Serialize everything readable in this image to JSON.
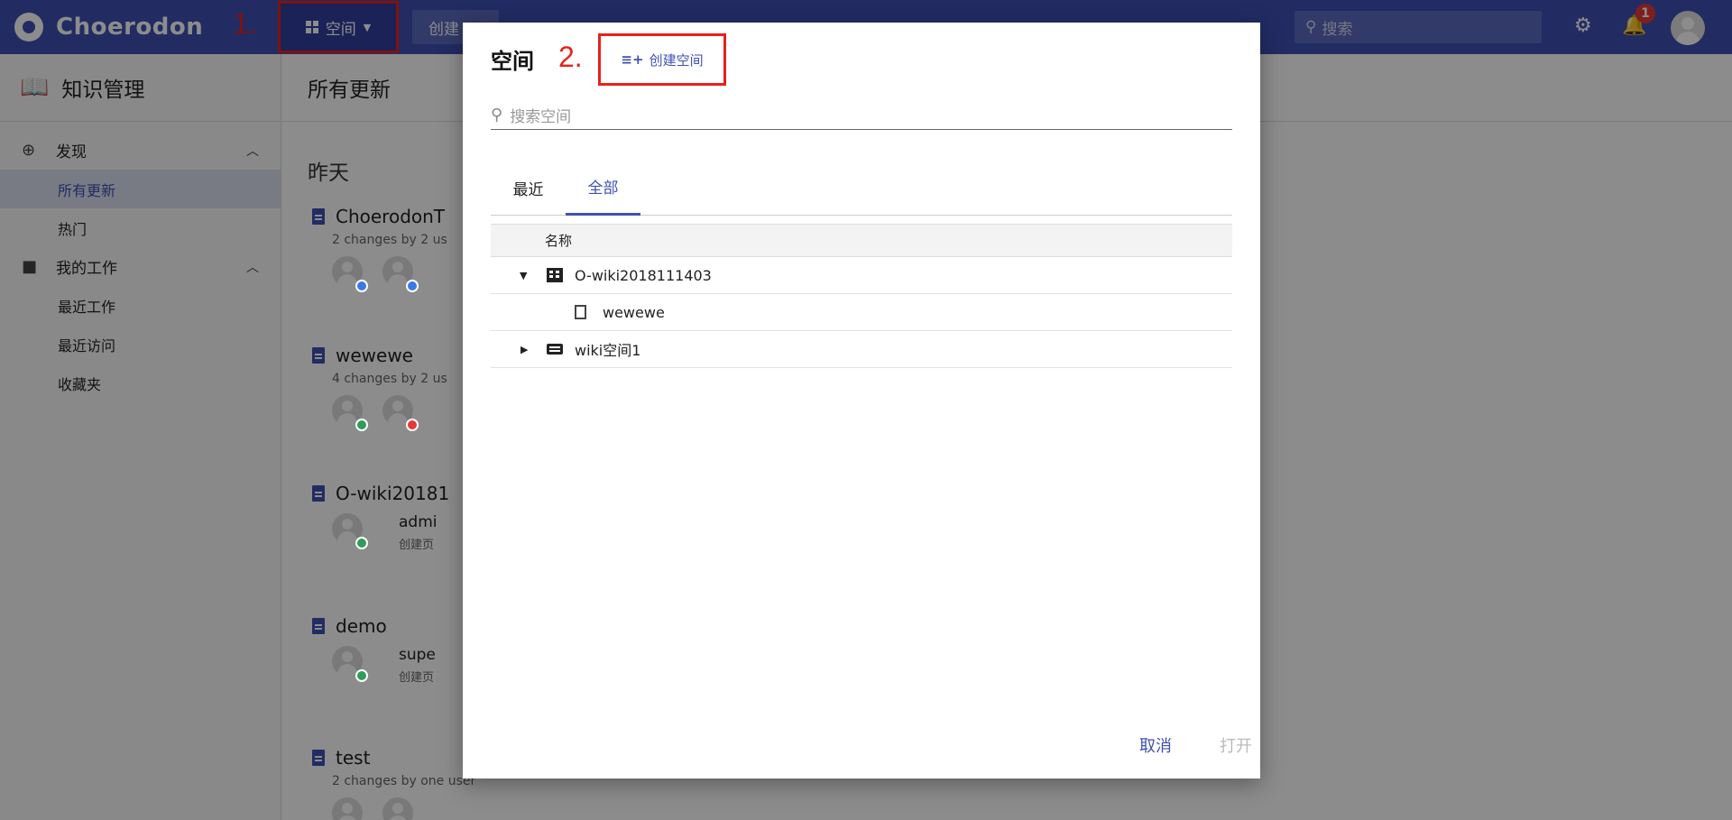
{
  "topbar": {
    "app_name": "Choerodon",
    "anno_1": "1.",
    "space_label": "空间",
    "create_label": "创建",
    "search_placeholder": "搜索",
    "notification_count": "1"
  },
  "sidebar": {
    "title": "知识管理",
    "groups": [
      {
        "label": "发现",
        "items": [
          "所有更新",
          "热门"
        ]
      },
      {
        "label": "我的工作",
        "items": [
          "最近工作",
          "最近访问",
          "收藏夹"
        ]
      }
    ]
  },
  "main": {
    "header": "所有更新",
    "day_label": "昨天",
    "feed": [
      {
        "title": "ChoerodonT",
        "sub": "2 changes by 2 us"
      },
      {
        "title": "wewewe",
        "sub": "4 changes by 2 us"
      },
      {
        "title": "O-wiki20181",
        "user": "admi",
        "meta": "创建页"
      },
      {
        "title": "demo",
        "user": "supe",
        "meta": "创建页"
      },
      {
        "title": "test",
        "sub": "2 changes by one user"
      }
    ]
  },
  "dialog": {
    "title": "空间",
    "anno_2": "2.",
    "create_space_label": "创建空间",
    "search_placeholder": "搜索空间",
    "tabs": [
      "最近",
      "全部"
    ],
    "active_tab": "全部",
    "column_name": "名称",
    "rows": [
      {
        "label": "O-wiki2018111403",
        "icon": "organization-icon",
        "expanded": true
      },
      {
        "label": "wewewe",
        "icon": "page-icon",
        "child": true
      },
      {
        "label": "wiki空间1",
        "icon": "keyboard-icon",
        "expanded": false
      }
    ],
    "cancel_label": "取消",
    "open_label": "打开"
  },
  "colors": {
    "primary": "#3f51b5",
    "annotation": "#e8211a",
    "badge": "#e53935"
  }
}
